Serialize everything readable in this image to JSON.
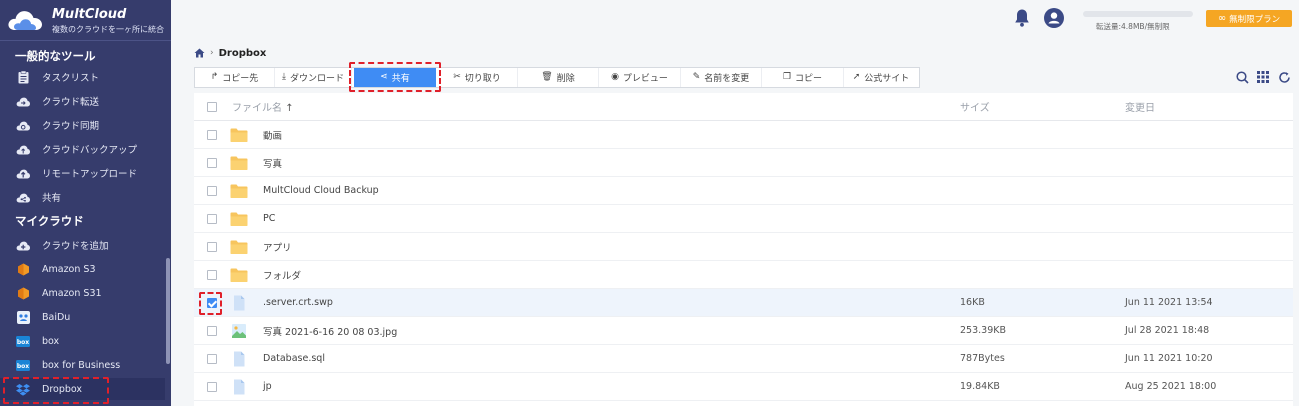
{
  "brand": {
    "name": "MultCloud",
    "tagline": "複数のクラウドを一ヶ所に統合"
  },
  "sidebar": {
    "section_tools": "一般的なツール",
    "tools": [
      {
        "label": "タスクリスト",
        "icon": "task-list-icon"
      },
      {
        "label": "クラウド転送",
        "icon": "cloud-transfer-icon"
      },
      {
        "label": "クラウド同期",
        "icon": "cloud-sync-icon"
      },
      {
        "label": "クラウドバックアップ",
        "icon": "cloud-backup-icon"
      },
      {
        "label": "リモートアップロード",
        "icon": "remote-upload-icon"
      },
      {
        "label": "共有",
        "icon": "share-cloud-icon"
      }
    ],
    "section_clouds": "マイクラウド",
    "clouds": [
      {
        "label": "クラウドを追加",
        "icon": "add-cloud-icon"
      },
      {
        "label": "Amazon S3",
        "icon": "amazon-s3-icon"
      },
      {
        "label": "Amazon S31",
        "icon": "amazon-s3-icon"
      },
      {
        "label": "BaiDu",
        "icon": "baidu-icon"
      },
      {
        "label": "box",
        "icon": "box-icon"
      },
      {
        "label": "box for Business",
        "icon": "box-icon"
      },
      {
        "label": "Dropbox",
        "icon": "dropbox-icon"
      }
    ]
  },
  "topbar": {
    "transfer_text": "転送量:4.8MB/無制限",
    "upgrade_label": "無制限プラン"
  },
  "breadcrumb": {
    "current": "Dropbox"
  },
  "toolbar": {
    "copy_to": "コピー先",
    "download": "ダウンロード",
    "share": "共有",
    "cut": "切り取り",
    "delete": "削除",
    "preview": "プレビュー",
    "rename": "名前を変更",
    "copy": "コピー",
    "official_site": "公式サイト"
  },
  "table": {
    "headers": {
      "name": "ファイル名",
      "size": "サイズ",
      "modified": "変更日"
    },
    "sort_arrow": "↑",
    "rows": [
      {
        "name": "動画",
        "type": "folder",
        "size": "",
        "date": "",
        "checked": false
      },
      {
        "name": "写真",
        "type": "folder",
        "size": "",
        "date": "",
        "checked": false
      },
      {
        "name": "MultCloud Cloud Backup",
        "type": "folder",
        "size": "",
        "date": "",
        "checked": false
      },
      {
        "name": "PC",
        "type": "folder",
        "size": "",
        "date": "",
        "checked": false
      },
      {
        "name": "アプリ",
        "type": "folder",
        "size": "",
        "date": "",
        "checked": false
      },
      {
        "name": "フォルダ",
        "type": "folder",
        "size": "",
        "date": "",
        "checked": false
      },
      {
        "name": ".server.crt.swp",
        "type": "file",
        "size": "16KB",
        "date": "Jun 11 2021 13:54",
        "checked": true
      },
      {
        "name": "写真 2021-6-16 20 08 03.jpg",
        "type": "image",
        "size": "253.39KB",
        "date": "Jul 28 2021 18:48",
        "checked": false
      },
      {
        "name": "Database.sql",
        "type": "file",
        "size": "787Bytes",
        "date": "Jun 11 2021 10:20",
        "checked": false
      },
      {
        "name": "jp",
        "type": "file",
        "size": "19.84KB",
        "date": "Aug 25 2021 18:00",
        "checked": false
      }
    ]
  },
  "colors": {
    "sidebar_bg": "#363c6c",
    "accent": "#3f8cf4",
    "upgrade": "#f5a623",
    "highlight_dash": "#e0202a",
    "folder": "#f7c55e"
  }
}
